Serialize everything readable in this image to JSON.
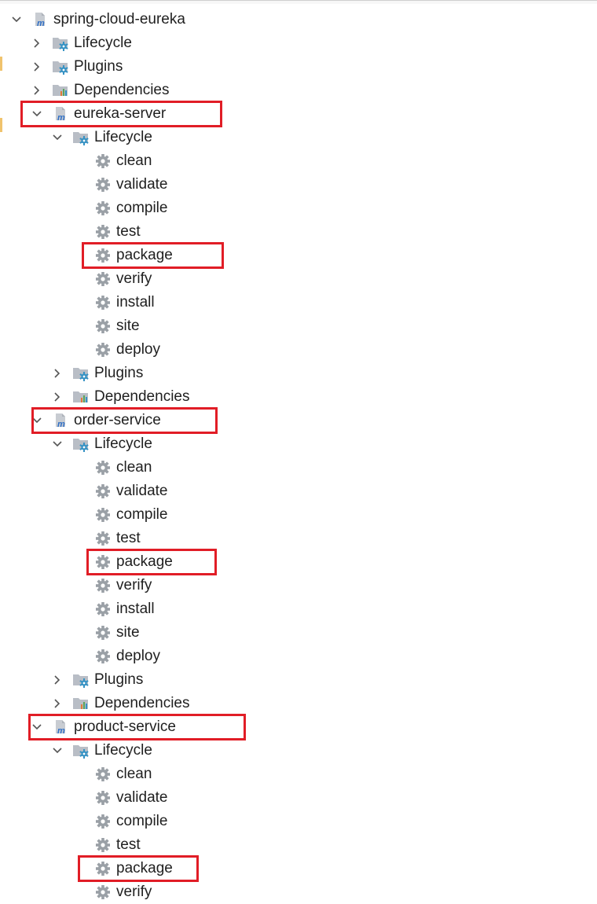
{
  "tree": {
    "root": {
      "label": "spring-cloud-eureka",
      "lifecycle": "Lifecycle",
      "plugins": "Plugins",
      "dependencies": "Dependencies"
    },
    "modules": [
      {
        "name": "eureka-server",
        "lifecycle": "Lifecycle",
        "goals": [
          "clean",
          "validate",
          "compile",
          "test",
          "package",
          "verify",
          "install",
          "site",
          "deploy"
        ],
        "plugins": "Plugins",
        "dependencies": "Dependencies"
      },
      {
        "name": "order-service",
        "lifecycle": "Lifecycle",
        "goals": [
          "clean",
          "validate",
          "compile",
          "test",
          "package",
          "verify",
          "install",
          "site",
          "deploy"
        ],
        "plugins": "Plugins",
        "dependencies": "Dependencies"
      },
      {
        "name": "product-service",
        "lifecycle": "Lifecycle",
        "goals": [
          "clean",
          "validate",
          "compile",
          "test",
          "package",
          "verify"
        ]
      }
    ]
  },
  "colors": {
    "highlight": "#e11d26",
    "gear": "#9aa0a6",
    "maven_m": "#2f6fc6",
    "folder_gear": "#3592c4"
  },
  "icons": {
    "expanded": "chevron-down-icon",
    "collapsed": "chevron-right-icon",
    "module": "maven-module-icon",
    "lifecycle": "lifecycle-folder-icon",
    "plugins": "plugins-folder-icon",
    "dependencies": "dependencies-folder-icon",
    "goal": "gear-icon"
  }
}
